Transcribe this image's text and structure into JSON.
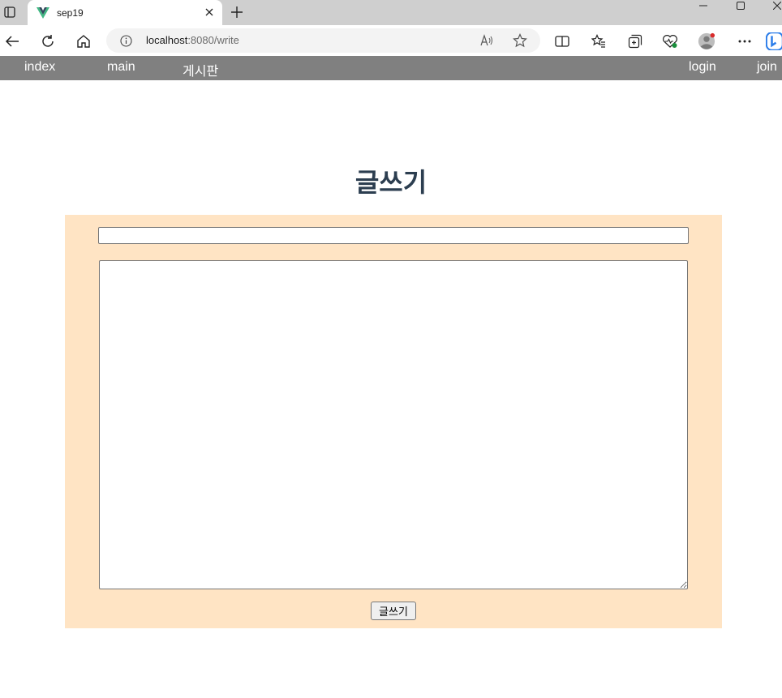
{
  "browser": {
    "tab_title": "sep19",
    "url_host": "localhost",
    "url_rest": ":8080/write"
  },
  "nav": {
    "left": [
      "index",
      "main",
      "게시판"
    ],
    "right": [
      "login",
      "join"
    ]
  },
  "page": {
    "title": "글쓰기",
    "title_input_value": "",
    "content_value": "",
    "submit_label": "글쓰기"
  },
  "colors": {
    "nav_bg": "#808080",
    "panel_bg": "#ffe4c4",
    "title_color": "#2c3e50"
  }
}
